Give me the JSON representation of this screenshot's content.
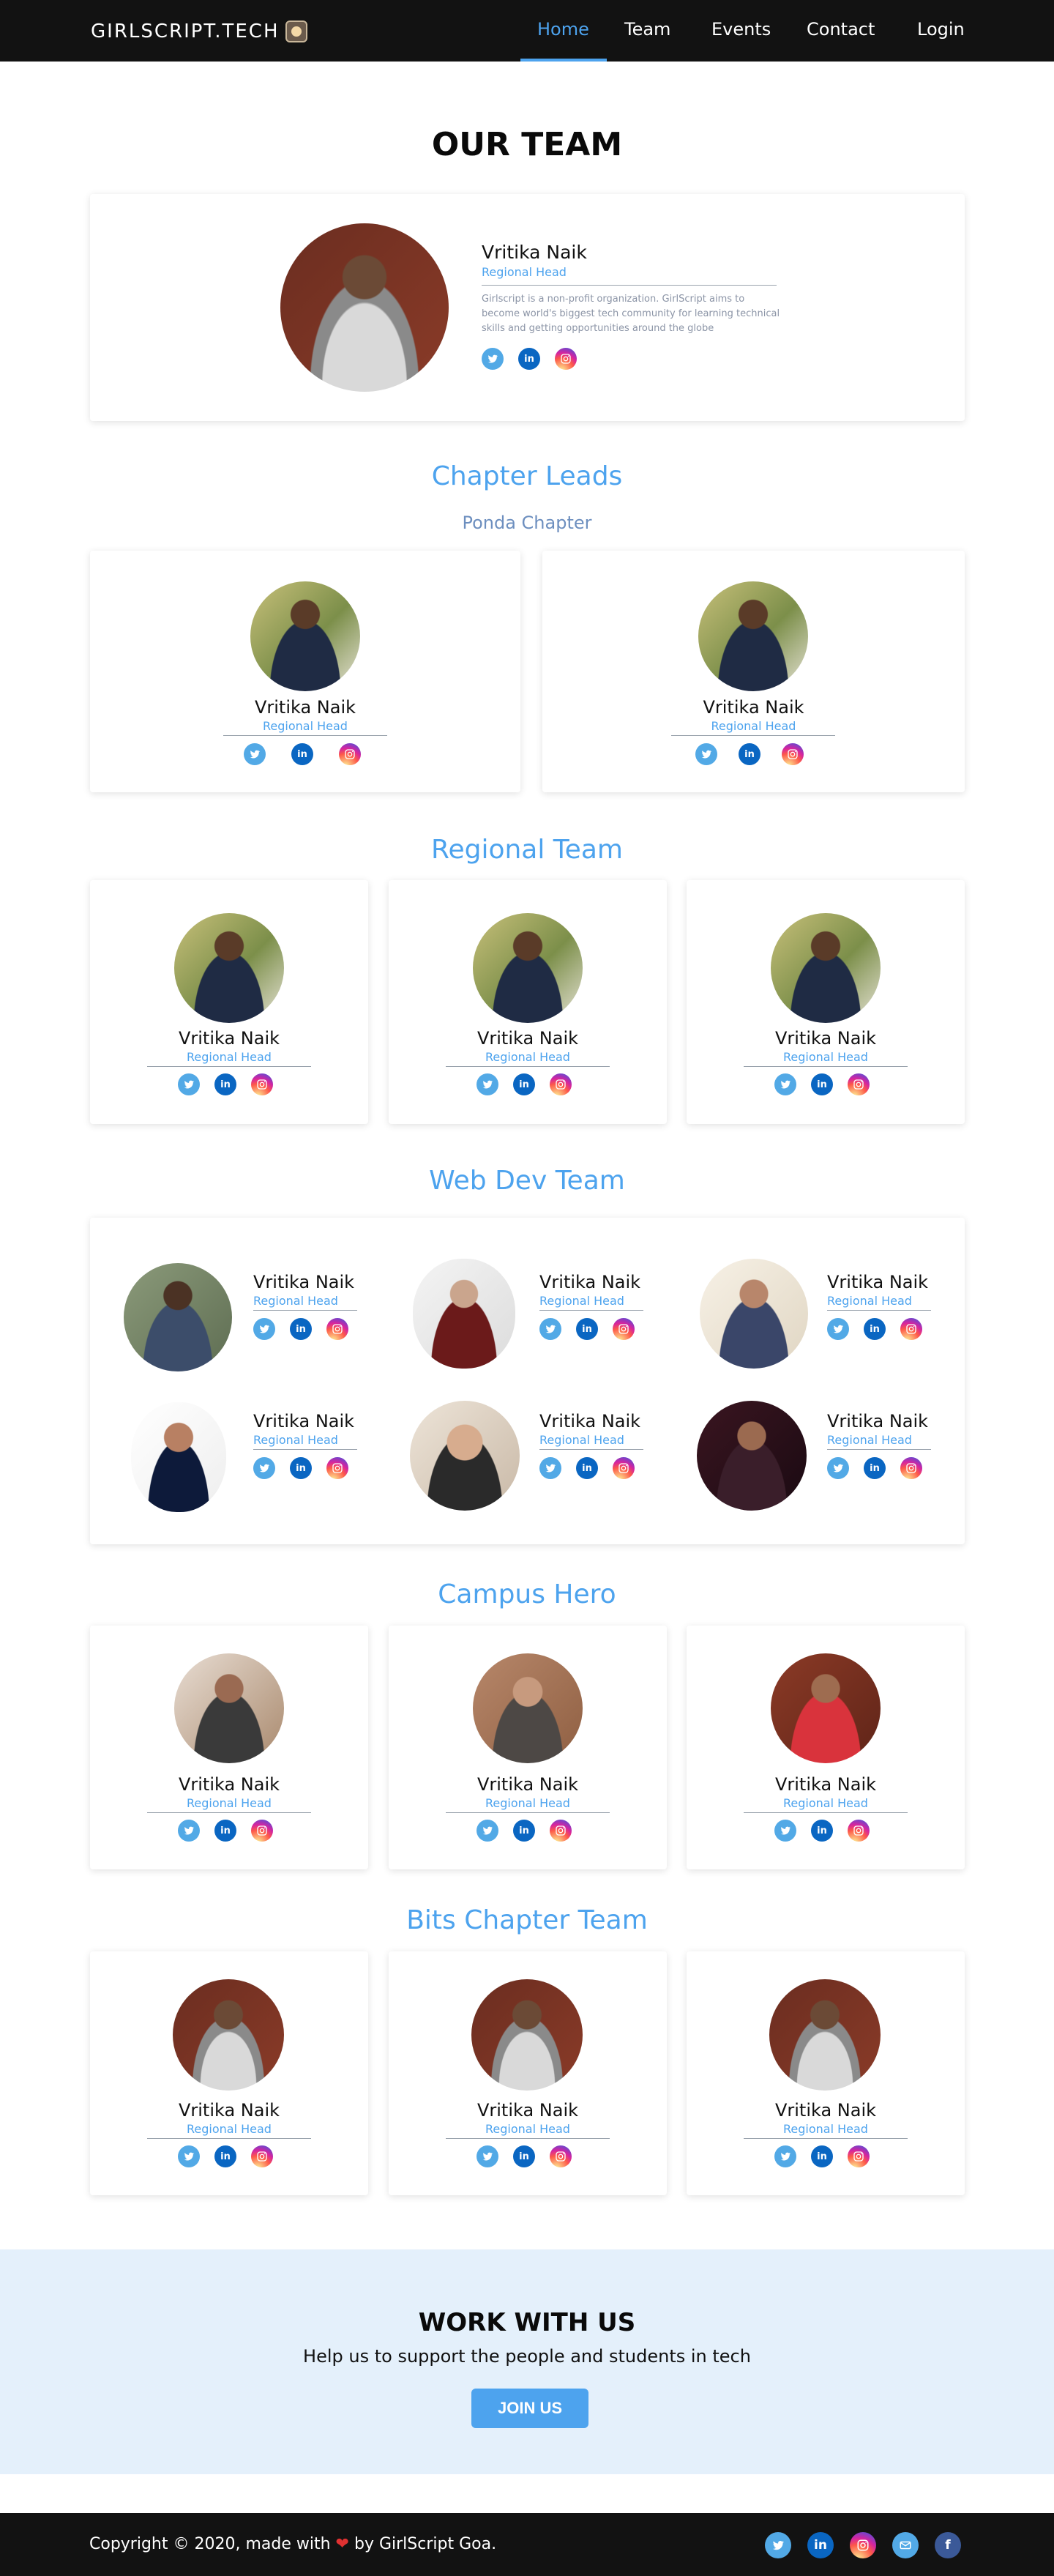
{
  "nav": {
    "brand": "GIRLSCRIPT.TECH",
    "items": [
      {
        "label": "Home",
        "active": true
      },
      {
        "label": "Team"
      },
      {
        "label": "Events"
      },
      {
        "label": "Contact"
      },
      {
        "label": "Login"
      }
    ]
  },
  "page_title": "OUR TEAM",
  "featured": {
    "name": "Vritika Naik",
    "role": "Regional Head",
    "description": "Girlscript is a non-profit organization. GirlScript aims to become world's biggest tech community for learning technical skills and getting opportunities around the globe"
  },
  "chapter_leads": {
    "title": "Chapter Leads",
    "subtitle": "Ponda Chapter",
    "members": [
      {
        "name": "Vritika Naik",
        "role": "Regional Head"
      },
      {
        "name": "Vritika Naik",
        "role": "Regional Head"
      }
    ]
  },
  "regional_team": {
    "title": "Regional Team",
    "members": [
      {
        "name": "Vritika Naik",
        "role": "Regional Head"
      },
      {
        "name": "Vritika Naik",
        "role": "Regional Head"
      },
      {
        "name": "Vritika Naik",
        "role": "Regional Head"
      }
    ]
  },
  "web_dev_team": {
    "title": "Web Dev Team",
    "members": [
      {
        "name": "Vritika Naik",
        "role": "Regional Head"
      },
      {
        "name": "Vritika Naik",
        "role": "Regional Head"
      },
      {
        "name": "Vritika Naik",
        "role": "Regional Head"
      },
      {
        "name": "Vritika Naik",
        "role": "Regional Head"
      },
      {
        "name": "Vritika Naik",
        "role": "Regional Head"
      },
      {
        "name": "Vritika Naik",
        "role": "Regional Head"
      }
    ]
  },
  "campus_hero": {
    "title": "Campus Hero",
    "members": [
      {
        "name": "Vritika Naik",
        "role": "Regional Head"
      },
      {
        "name": "Vritika Naik",
        "role": "Regional Head"
      },
      {
        "name": "Vritika Naik",
        "role": "Regional Head"
      }
    ]
  },
  "bits_chapter": {
    "title": "Bits Chapter Team",
    "members": [
      {
        "name": "Vritika Naik",
        "role": "Regional Head"
      },
      {
        "name": "Vritika Naik",
        "role": "Regional Head"
      },
      {
        "name": "Vritika Naik",
        "role": "Regional Head"
      }
    ]
  },
  "social_icons": {
    "twitter": "twitter-icon",
    "linkedin": "linkedin-icon",
    "instagram": "instagram-icon",
    "mail": "mail-icon",
    "facebook": "facebook-icon",
    "linkedin_text": "in",
    "facebook_text": "f"
  },
  "work_with_us": {
    "title": "WORK WITH US",
    "subtitle": "Help us to support the people and students in tech",
    "button": "JOIN US"
  },
  "footer": {
    "copy_before": "Copyright © 2020, made with",
    "heart": "❤",
    "copy_after": "by GirlScript Goa."
  },
  "colors": {
    "accent": "#4da3ee",
    "nav_bg": "#121212",
    "work_bg": "#e4f0fb"
  }
}
